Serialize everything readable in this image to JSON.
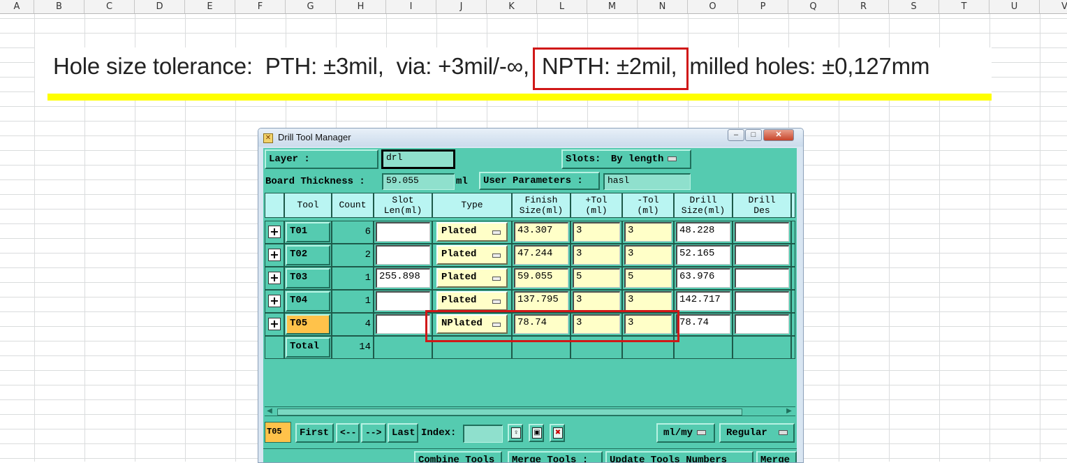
{
  "spreadsheet": {
    "columns": [
      "A",
      "B",
      "C",
      "D",
      "E",
      "F",
      "G",
      "H",
      "I",
      "J",
      "K",
      "L",
      "M",
      "N",
      "O",
      "P",
      "Q",
      "R",
      "S",
      "T",
      "U",
      "V"
    ]
  },
  "note": {
    "text": "Hole size tolerance:  PTH: ±3mil,  via: +3mil/-∞,  NPTH: ±2mil,  milled holes: ±0,127mm"
  },
  "window": {
    "title": "Drill Tool Manager",
    "layer_label": "Layer          :",
    "layer_value": "drl",
    "slots_label": "Slots:",
    "slots_value": "By length",
    "board_thickness_label": "Board Thickness :",
    "board_thickness_value": "59.055",
    "board_thickness_unit": "ml",
    "user_params_label": "User Parameters :",
    "user_params_value": "hasl"
  },
  "table": {
    "headers": [
      "Tool",
      "Count",
      "Slot\nLen(ml)",
      "Type",
      "Finish\nSize(ml)",
      "+Tol\n(ml)",
      "-Tol\n(ml)",
      "Drill\nSize(ml)",
      "Drill\nDes"
    ],
    "rows": [
      {
        "tool": "T01",
        "count": "6",
        "slot": "",
        "type": "Plated",
        "finish": "43.307",
        "ptol": "3",
        "mtol": "3",
        "drill": "48.228",
        "des": ""
      },
      {
        "tool": "T02",
        "count": "2",
        "slot": "",
        "type": "Plated",
        "finish": "47.244",
        "ptol": "3",
        "mtol": "3",
        "drill": "52.165",
        "des": ""
      },
      {
        "tool": "T03",
        "count": "1",
        "slot": "255.898",
        "type": "Plated",
        "finish": "59.055",
        "ptol": "5",
        "mtol": "5",
        "drill": "63.976",
        "des": ""
      },
      {
        "tool": "T04",
        "count": "1",
        "slot": "",
        "type": "Plated",
        "finish": "137.795",
        "ptol": "3",
        "mtol": "3",
        "drill": "142.717",
        "des": ""
      },
      {
        "tool": "T05",
        "count": "4",
        "slot": "",
        "type": "NPlated",
        "finish": "78.74",
        "ptol": "3",
        "mtol": "3",
        "drill": "78.74",
        "des": ""
      }
    ],
    "total_label": "Total",
    "total_count": "14"
  },
  "nav": {
    "current_tool": "T05",
    "first": "First",
    "prev": "<--",
    "next": "-->",
    "last": "Last",
    "index_label": "Index:",
    "units": "ml/my",
    "mode": "Regular"
  },
  "bottom": {
    "combine": "Combine Tools",
    "merge_tools": "Merge Tools :",
    "update": "Update Tools Numbers",
    "merge": "Merge"
  },
  "colors": {
    "panel": "#55cbb0",
    "header": "#b9f5f2",
    "highlight": "#d01818",
    "selected": "#ffc24a"
  }
}
